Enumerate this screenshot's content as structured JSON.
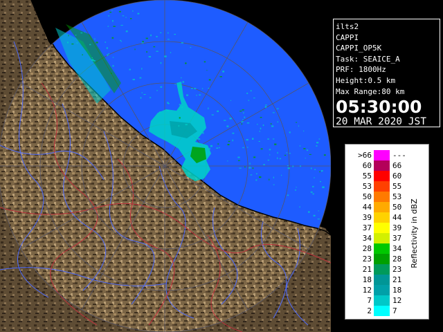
{
  "info": {
    "lines": [
      "ilts2",
      "CAPPI",
      "CAPPI_OP5K",
      "Task: SEAICE_A",
      "PRF: 1800Hz",
      "Height:0.5 km",
      "Max Range:80 km"
    ],
    "time": "05:30:00",
    "date": "20 MAR 2020 JST"
  },
  "legend": {
    "title": "Reflectivity in dBZ",
    "rows": [
      {
        "lo": ">66",
        "hi": "---",
        "color": "#ff00ff"
      },
      {
        "lo": "60",
        "hi": "66",
        "color": "#b4005a"
      },
      {
        "lo": "55",
        "hi": "60",
        "color": "#ff0000"
      },
      {
        "lo": "53",
        "hi": "55",
        "color": "#ff4000"
      },
      {
        "lo": "50",
        "hi": "53",
        "color": "#ff7a00"
      },
      {
        "lo": "44",
        "hi": "50",
        "color": "#ffaa00"
      },
      {
        "lo": "39",
        "hi": "44",
        "color": "#ffd200"
      },
      {
        "lo": "37",
        "hi": "39",
        "color": "#ffff00"
      },
      {
        "lo": "34",
        "hi": "37",
        "color": "#d2f000"
      },
      {
        "lo": "28",
        "hi": "34",
        "color": "#00c800"
      },
      {
        "lo": "23",
        "hi": "28",
        "color": "#00a000"
      },
      {
        "lo": "21",
        "hi": "23",
        "color": "#009a5a"
      },
      {
        "lo": "18",
        "hi": "21",
        "color": "#009696"
      },
      {
        "lo": "12",
        "hi": "18",
        "color": "#00a0a8"
      },
      {
        "lo": "7",
        "hi": "12",
        "color": "#00c8c8"
      },
      {
        "lo": "2",
        "hi": "7",
        "color": "#00ffff"
      }
    ]
  },
  "colors": {
    "sea": "#1e5cff",
    "land": "#8a7250",
    "echo": "#00d2c8",
    "coast": "#000000",
    "rivers": "#4d6bff",
    "borders": "#c0303c"
  }
}
